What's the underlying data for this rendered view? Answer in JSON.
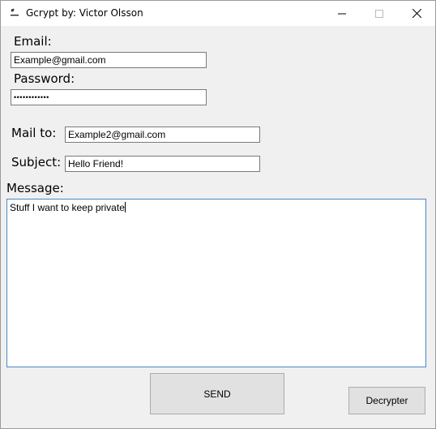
{
  "window": {
    "title": "Gcrypt by: Victor Olsson",
    "icon": "gcrypt-app-icon",
    "controls": [
      "minimize-icon",
      "maximize-icon",
      "close-icon"
    ]
  },
  "form": {
    "email_label": "Email:",
    "email_value": "Example@gmail.com",
    "password_label": "Password:",
    "password_value": "••••••••••••",
    "mailto_label": "Mail to:",
    "mailto_value": "Example2@gmail.com",
    "subject_label": "Subject:",
    "subject_value": "Hello Friend!",
    "message_label": "Message:",
    "message_value": "Stuff I want to keep private"
  },
  "buttons": {
    "send_label": "SEND",
    "decrypter_label": "Decrypter"
  },
  "colors": {
    "background": "#f0f0f0",
    "focus_border": "#4a86c8",
    "button_face": "#e1e1e1"
  }
}
